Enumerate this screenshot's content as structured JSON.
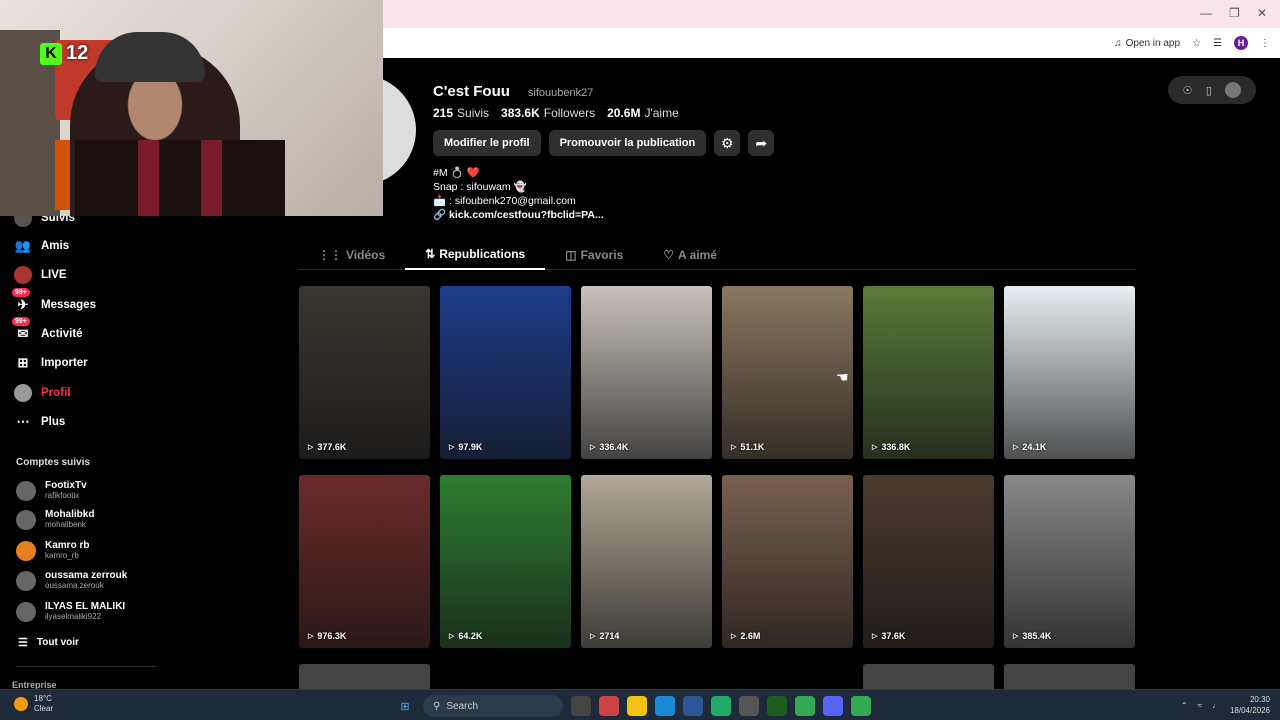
{
  "browser": {
    "open_in_app_label": "Open in app",
    "profile_initial": "H"
  },
  "stream_overlay": {
    "kick_count": "12"
  },
  "profile": {
    "display_name": "C'est Fouu",
    "username": "sifouubenk27",
    "stats": [
      {
        "value": "215",
        "label": "Suivis"
      },
      {
        "value": "383.6K",
        "label": "Followers"
      },
      {
        "value": "20.6M",
        "label": "J'aime"
      }
    ],
    "edit_button": "Modifier le profil",
    "promote_button": "Promouvoir la publication",
    "bio_lines": [
      "#M 💍 ❤️",
      "Snap : sifouwam 👻",
      "📩 : sifoubenk270@gmail.com"
    ],
    "link": "kick.com/cestfouu?fbclid=PA..."
  },
  "tabs": [
    {
      "label": "Vidéos",
      "icon": "grid-icon",
      "active": false
    },
    {
      "label": "Republications",
      "icon": "repost-icon",
      "active": true
    },
    {
      "label": "Favoris",
      "icon": "bookmark-icon",
      "active": false
    },
    {
      "label": "A aimé",
      "icon": "heart-icon",
      "active": false
    }
  ],
  "sidebar": {
    "items": [
      {
        "label": "Suivis",
        "icon": "following-icon"
      },
      {
        "label": "Amis",
        "icon": "friends-icon"
      },
      {
        "label": "LIVE",
        "icon": "live-icon"
      },
      {
        "label": "Messages",
        "icon": "messages-icon",
        "badge": "99+"
      },
      {
        "label": "Activité",
        "icon": "activity-icon",
        "badge": "99+"
      },
      {
        "label": "Importer",
        "icon": "upload-icon"
      },
      {
        "label": "Profil",
        "icon": "profile-icon",
        "active": true
      },
      {
        "label": "Plus",
        "icon": "more-icon"
      }
    ],
    "section_title": "Comptes suivis",
    "following": [
      {
        "name": "FootixTv",
        "user": "rafikfootix"
      },
      {
        "name": "Mohalibkd",
        "user": "mohalibenk"
      },
      {
        "name": "Kamro rb",
        "user": "kamro_rb"
      },
      {
        "name": "oussama zerrouk",
        "user": "oussama.zerouk"
      },
      {
        "name": "ILYAS EL MALIKI",
        "user": "ilyaselmaliki922"
      }
    ],
    "see_all": "Tout voir",
    "footer": "Entreprise"
  },
  "videos": [
    {
      "views": "377.6K",
      "color": "#3a3530"
    },
    {
      "views": "97.9K",
      "color": "#1d3c8a"
    },
    {
      "views": "336.4K",
      "color": "#c8c2bc"
    },
    {
      "views": "51.1K",
      "color": "#8a7860"
    },
    {
      "views": "336.8K",
      "color": "#5a7a3a"
    },
    {
      "views": "24.1K",
      "color": "#e8eef2"
    },
    {
      "views": "976.3K",
      "color": "#6a2a2a"
    },
    {
      "views": "64.2K",
      "color": "#2e7d32"
    },
    {
      "views": "2714",
      "color": "#b0a898"
    },
    {
      "views": "2.6M",
      "color": "#7a6050"
    },
    {
      "views": "37.6K",
      "color": "#4a3a30"
    },
    {
      "views": "385.4K",
      "color": "#888888"
    }
  ],
  "taskbar": {
    "temp": "18°C",
    "weather": "Clear",
    "search_label": "Search",
    "time": "20:30",
    "date": "18/04/2026"
  }
}
